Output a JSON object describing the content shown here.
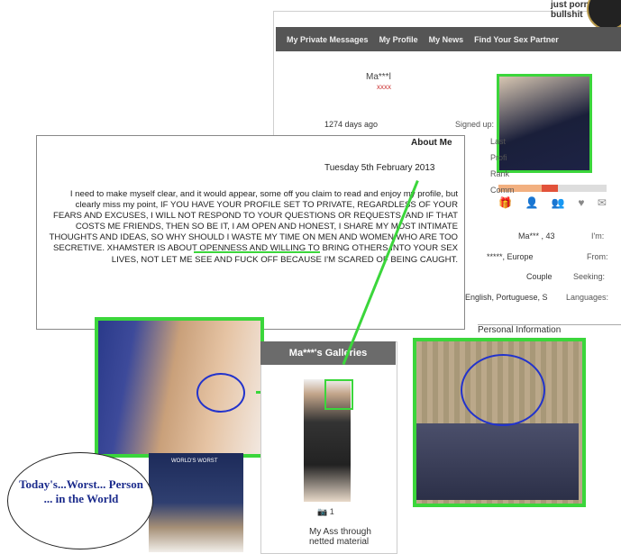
{
  "header": {
    "tagline": "just porn, no bullshit"
  },
  "nav": {
    "items": [
      "My Private Messages",
      "My Profile",
      "My News",
      "Find Your Sex Partner"
    ]
  },
  "profile": {
    "username": "Ma***l",
    "user_sub": "xxxx",
    "signed_up_label": "Signed up:",
    "signed_up_value": "1274 days ago",
    "last_label": "Last",
    "profile_label": "Profi",
    "rank_label": "Rank",
    "comments_label": "Comm",
    "im_label": "I'm:",
    "im_value": "Ma*** , 43",
    "from_label": "From:",
    "from_value": "*****, Europe",
    "seeking_label": "Seeking:",
    "seeking_value": "Couple",
    "languages_label": "Languages:",
    "languages_value": "English, Portuguese, S",
    "personal_info": "Personal Information"
  },
  "about": {
    "title": "About Me",
    "date": "Tuesday 5th February 2013",
    "text": "I need to make myself clear, and it would appear, some off you claim to read and enjoy my profile, but clearly miss my point, IF YOU HAVE YOUR PROFILE SET TO PRIVATE, REGARDLESS OF YOUR FEARS AND EXCUSES, I WILL NOT RESPOND TO YOUR QUESTIONS OR REQUESTS, AND IF THAT COSTS ME FRIENDS, THEN SO BE IT, I AM OPEN AND HONEST, I SHARE MY MOST INTIMATE THOUGHTS AND IDEAS, SO WHY SHOULD I WASTE MY TIME ON MEN AND WOMEN WHO ARE TOO SECRETIVE. XHAMSTER IS ABOUT OPENNESS AND WILLING TO BRING OTHERS INTO YOUR SEX LIVES, NOT LET ME SEE AND FUCK OFF BECAUSE I'M SCARED OF BEING CAUGHT."
  },
  "galleries": {
    "title": "Ma***'s Galleries",
    "count": "1",
    "caption": "My Ass through netted material"
  },
  "overlay": {
    "bubble": "Today's...Worst... Person ... in the World",
    "tv_label": "WORLD'S WORST"
  },
  "colors": {
    "highlight": "#3bd63b",
    "circle": "#2233cc",
    "bubble_text": "#1b2b8c"
  }
}
